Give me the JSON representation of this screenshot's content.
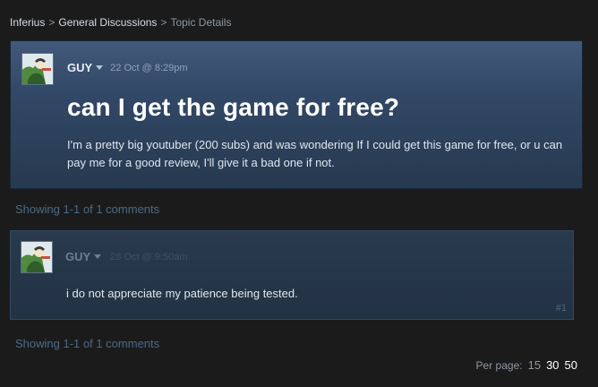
{
  "breadcrumb": {
    "items": [
      "Inferius",
      "General Discussions"
    ],
    "current": "Topic Details",
    "separator": ">"
  },
  "topic": {
    "author": "GUY",
    "date": "22 Oct @ 8:29pm",
    "title": "can I get the game for free?",
    "body": "I'm a pretty big youtuber (200 subs) and was wondering If I could get this game for free, or u can pay me for a good review, I'll give it a bad one if not."
  },
  "showing_top": "Showing 1-1 of 1 comments",
  "comment": {
    "author": "GUY",
    "date": "28 Oct @ 9:50am",
    "text": "i do not appreciate my patience being tested.",
    "index": "#1"
  },
  "showing_bottom": "Showing 1-1 of 1 comments",
  "pagination": {
    "label": "Per page:",
    "options": [
      "15",
      "30",
      "50"
    ],
    "selected": "30"
  },
  "colors": {
    "background": "#1b1b1c",
    "panel": "#324867",
    "comment_panel": "#223244",
    "muted_link": "#4d6a86"
  }
}
